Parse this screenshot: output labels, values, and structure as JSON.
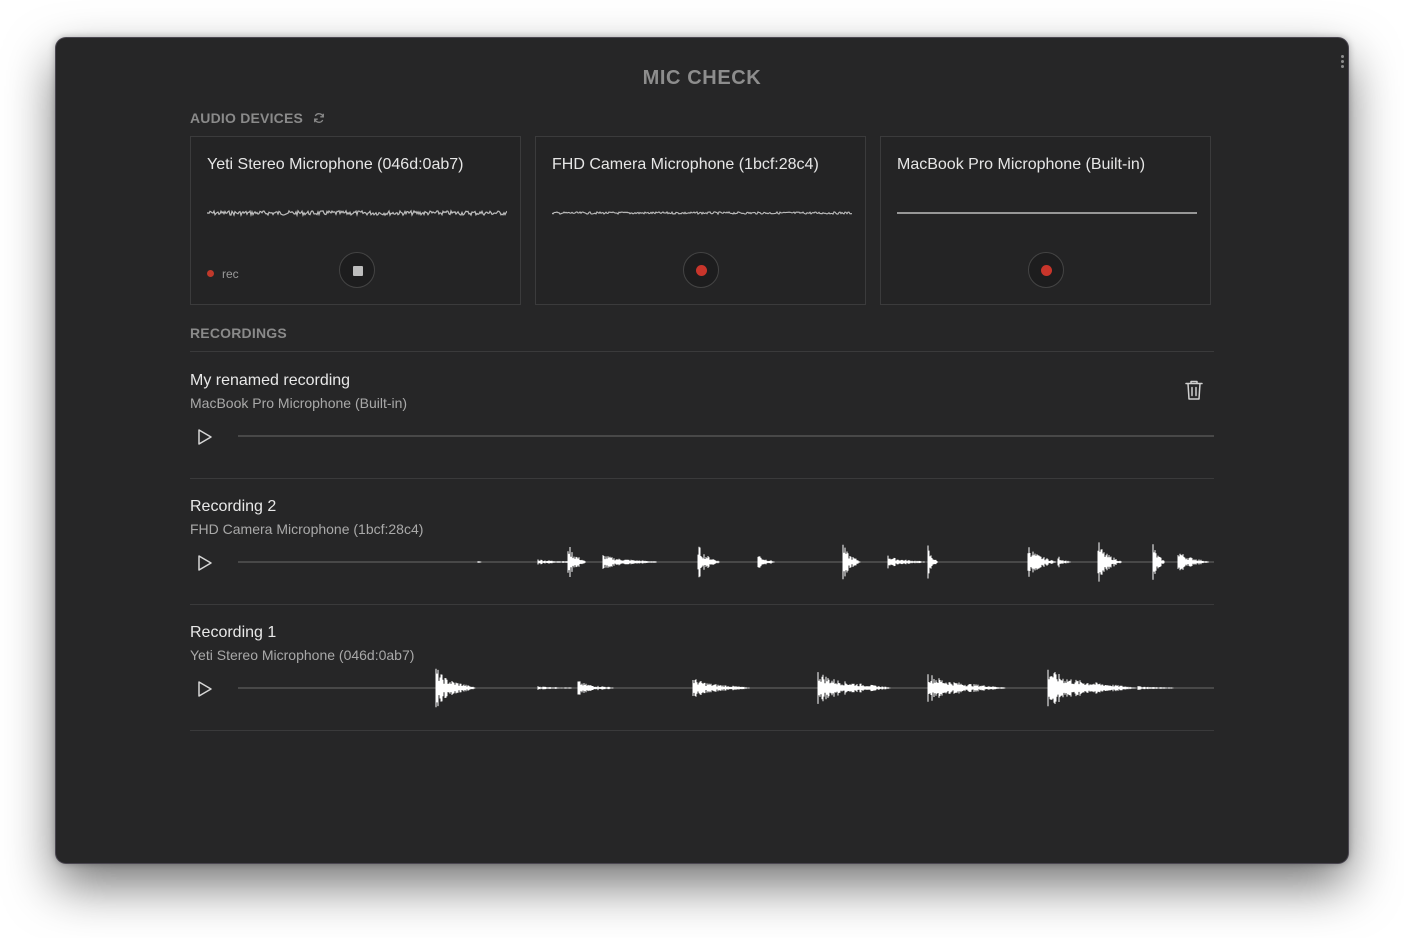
{
  "app": {
    "title": "MIC CHECK"
  },
  "audio_devices": {
    "label": "AUDIO DEVICES",
    "refresh_icon": "refresh-icon",
    "devices": [
      {
        "name": "Yeti Stereo Microphone (046d:0ab7)",
        "recording": true,
        "rec_label": "rec",
        "button": "stop"
      },
      {
        "name": "FHD Camera Microphone (1bcf:28c4)",
        "recording": false,
        "button": "record"
      },
      {
        "name": "MacBook Pro Microphone (Built-in)",
        "recording": false,
        "button": "record"
      }
    ]
  },
  "recordings": {
    "label": "RECORDINGS",
    "items": [
      {
        "title": "My renamed recording",
        "device": "MacBook Pro Microphone (Built-in)",
        "has_delete": true
      },
      {
        "title": "Recording 2",
        "device": "FHD Camera Microphone (1bcf:28c4)",
        "has_delete": false
      },
      {
        "title": "Recording 1",
        "device": "Yeti Stereo Microphone (046d:0ab7)",
        "has_delete": false
      }
    ]
  },
  "colors": {
    "background": "#262627",
    "record_red": "#c8352b",
    "waveform": "#ffffff"
  },
  "icons": [
    "more-vertical-icon",
    "refresh-icon",
    "stop-icon",
    "record-icon",
    "play-icon",
    "trash-icon"
  ]
}
